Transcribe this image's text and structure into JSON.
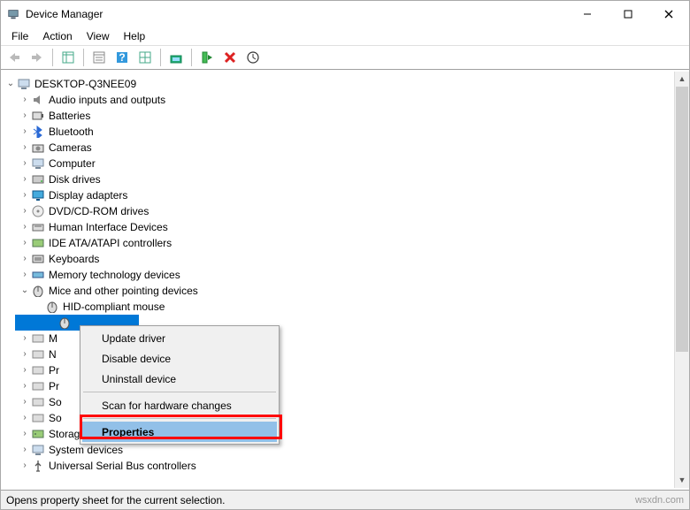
{
  "window": {
    "title": "Device Manager"
  },
  "menus": {
    "file": "File",
    "action": "Action",
    "view": "View",
    "help": "Help"
  },
  "root": "DESKTOP-Q3NEE09",
  "categories": [
    "Audio inputs and outputs",
    "Batteries",
    "Bluetooth",
    "Cameras",
    "Computer",
    "Disk drives",
    "Display adapters",
    "DVD/CD-ROM drives",
    "Human Interface Devices",
    "IDE ATA/ATAPI controllers",
    "Keyboards",
    "Memory technology devices"
  ],
  "open_category": "Mice and other pointing devices",
  "mouse_items": [
    "HID-compliant mouse"
  ],
  "truncated_categories": [
    "M",
    "N",
    "Pr",
    "Pr",
    "So",
    "So"
  ],
  "bottom_categories": [
    "Storage controllers",
    "System devices",
    "Universal Serial Bus controllers"
  ],
  "context_menu": {
    "update": "Update driver",
    "disable": "Disable device",
    "uninstall": "Uninstall device",
    "scan": "Scan for hardware changes",
    "properties": "Properties"
  },
  "status": "Opens property sheet for the current selection.",
  "watermark": "wsxdn.com"
}
